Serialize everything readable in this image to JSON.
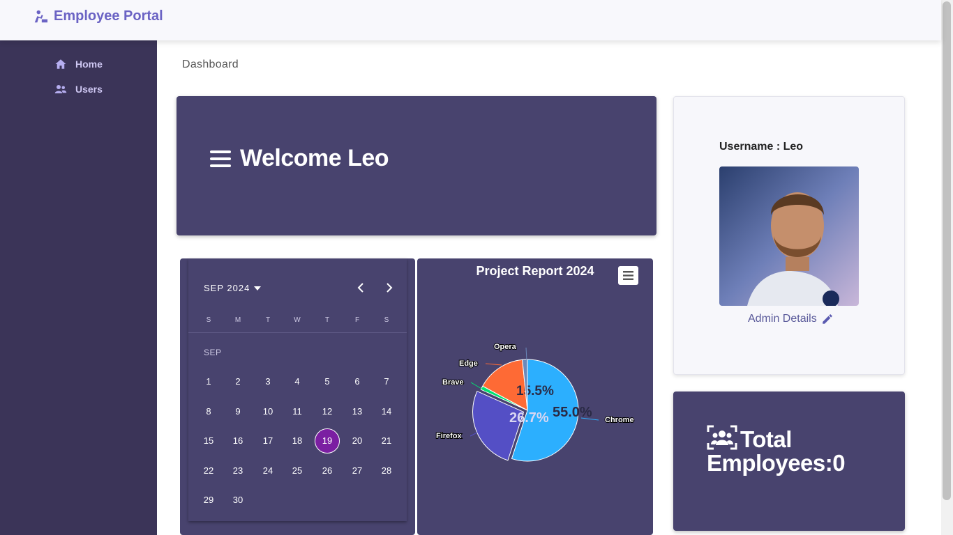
{
  "app": {
    "title": "Employee Portal"
  },
  "sidebar": {
    "items": [
      {
        "label": "Home",
        "icon": "home-icon"
      },
      {
        "label": "Users",
        "icon": "users-icon"
      }
    ]
  },
  "breadcrumb": "Dashboard",
  "welcome": {
    "title": "Welcome Leo",
    "icon": "menu-icon"
  },
  "profile": {
    "username_label": "Username : Leo",
    "admin_link": "Admin Details",
    "link_icon": "pencil-icon"
  },
  "total": {
    "text": "Total Employees:0",
    "icon": "users-icon"
  },
  "calendar": {
    "header": "SEP 2024",
    "month_label": "SEP",
    "weekdays": [
      "S",
      "M",
      "T",
      "W",
      "T",
      "F",
      "S"
    ],
    "days": [
      "1",
      "2",
      "3",
      "4",
      "5",
      "6",
      "7",
      "8",
      "9",
      "10",
      "11",
      "12",
      "13",
      "14",
      "15",
      "16",
      "17",
      "18",
      "19",
      "20",
      "21",
      "22",
      "23",
      "24",
      "25",
      "26",
      "27",
      "28",
      "29",
      "30"
    ],
    "first_day_column": 0,
    "selected": "19",
    "selected_color": "#7b1fa2"
  },
  "chart_data": {
    "type": "pie",
    "title": "Project Report 2024",
    "series": [
      {
        "name": "Chrome",
        "value": 55.0,
        "label": "55.0%",
        "color": "#2caffe"
      },
      {
        "name": "Firefox",
        "value": 26.7,
        "label": "26.7%",
        "color": "#544fc5"
      },
      {
        "name": "Brave",
        "value": 1.2,
        "label": "",
        "color": "#00e272"
      },
      {
        "name": "Edge",
        "value": 15.5,
        "label": "15.5%",
        "color": "#fe6a35"
      },
      {
        "name": "Opera",
        "value": 1.6,
        "label": "",
        "color": "#6b8abc"
      }
    ]
  },
  "colors": {
    "panel": "#48436e",
    "sidebar": "#3b3458",
    "brand": "#6b63c4"
  }
}
